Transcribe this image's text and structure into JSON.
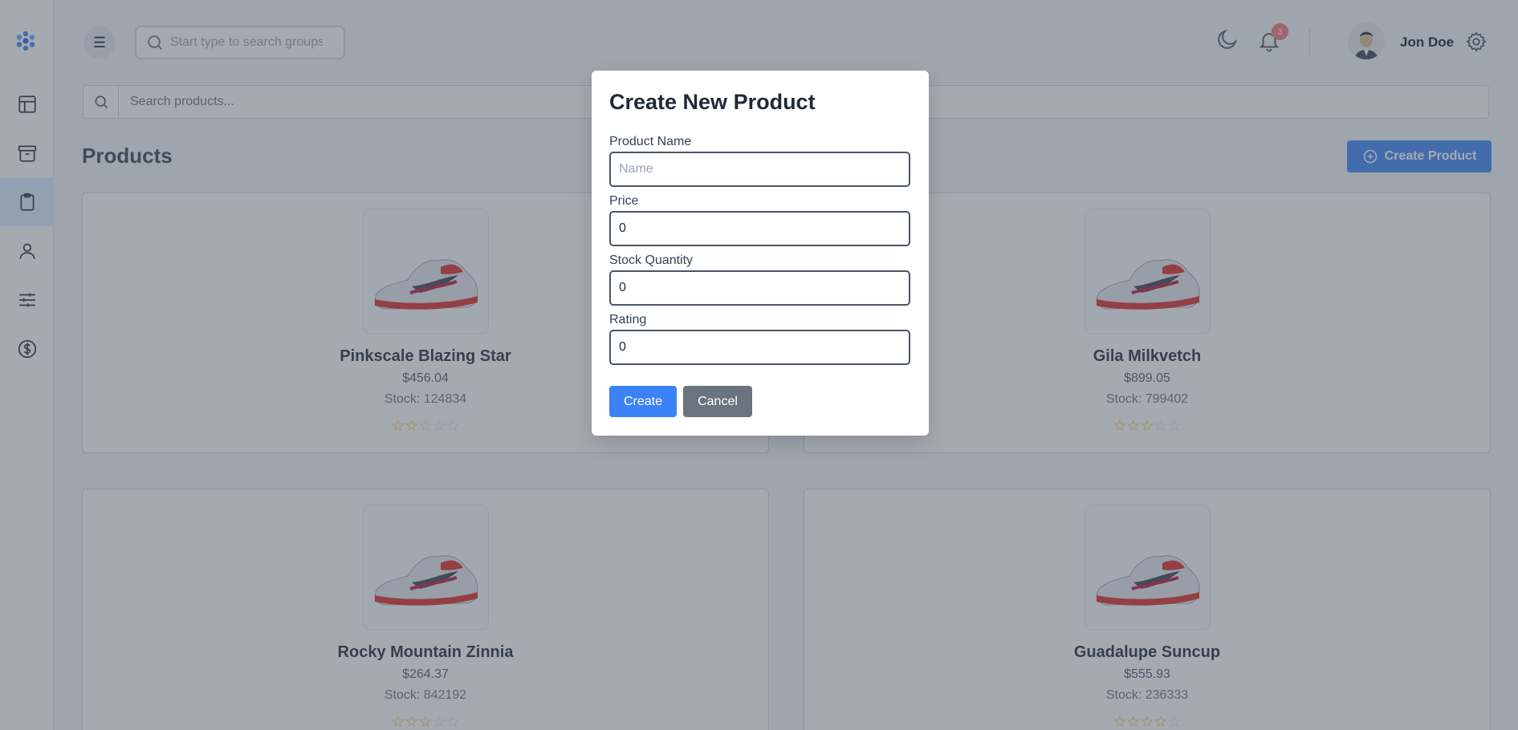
{
  "sidebar": {
    "items": [
      {
        "icon": "layout-icon",
        "active": false
      },
      {
        "icon": "archive-icon",
        "active": false
      },
      {
        "icon": "clipboard-icon",
        "active": true
      },
      {
        "icon": "user-icon",
        "active": false
      },
      {
        "icon": "sliders-icon",
        "active": false
      },
      {
        "icon": "dollar-circle-icon",
        "active": false
      }
    ]
  },
  "header": {
    "search_placeholder": "Start type to search groups",
    "notification_count": "3",
    "user_name": "Jon Doe"
  },
  "products_page": {
    "search_placeholder": "Search products...",
    "title": "Products",
    "create_button_label": "Create Product",
    "products": [
      {
        "name": "Pinkscale Blazing Star",
        "price": "$456.04",
        "stock": "Stock: 124834",
        "rating": 2
      },
      {
        "name": "Gila Milkvetch",
        "price": "$899.05",
        "stock": "Stock: 799402",
        "rating": 3
      },
      {
        "name": "Rocky Mountain Zinnia",
        "price": "$264.37",
        "stock": "Stock: 842192",
        "rating": 3
      },
      {
        "name": "Guadalupe Suncup",
        "price": "$555.93",
        "stock": "Stock: 236333",
        "rating": 4
      }
    ]
  },
  "modal": {
    "title": "Create New Product",
    "fields": {
      "name": {
        "label": "Product Name",
        "placeholder": "Name",
        "value": ""
      },
      "price": {
        "label": "Price",
        "value": "0"
      },
      "stock": {
        "label": "Stock Quantity",
        "value": "0"
      },
      "rating": {
        "label": "Rating",
        "value": "0"
      }
    },
    "create_label": "Create",
    "cancel_label": "Cancel"
  },
  "colors": {
    "accent": "#3b82f6",
    "active_nav_bg": "#dbeafe",
    "badge": "#f87171",
    "star": "#eab308",
    "cancel_button": "#6b7280"
  }
}
